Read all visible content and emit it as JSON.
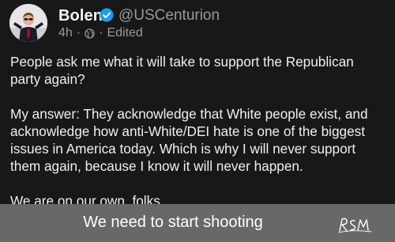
{
  "post": {
    "author_name": "Bolen",
    "handle": "@USCenturion",
    "time": "4h",
    "separator": "·",
    "edited": "Edited",
    "verified": true,
    "paragraphs": [
      "People ask me what it will take to support the Republican party again?",
      "My answer: They acknowledge that White people exist, and acknowledge how anti-White/DEI hate is one of the biggest issues in America today. Which is why I will never support them again, because I know it will never happen.",
      "We are on our own, folks."
    ]
  },
  "caption": {
    "text": "We need to start shooting",
    "signature": "RSM"
  },
  "colors": {
    "background": "#181818",
    "text": "#f0f0f0",
    "muted": "#9a9a9a",
    "verified_blue": "#1d9bf0",
    "caption_bar": "#686868"
  },
  "icons": [
    "avatar-image",
    "verified-badge-icon",
    "globe-icon"
  ]
}
